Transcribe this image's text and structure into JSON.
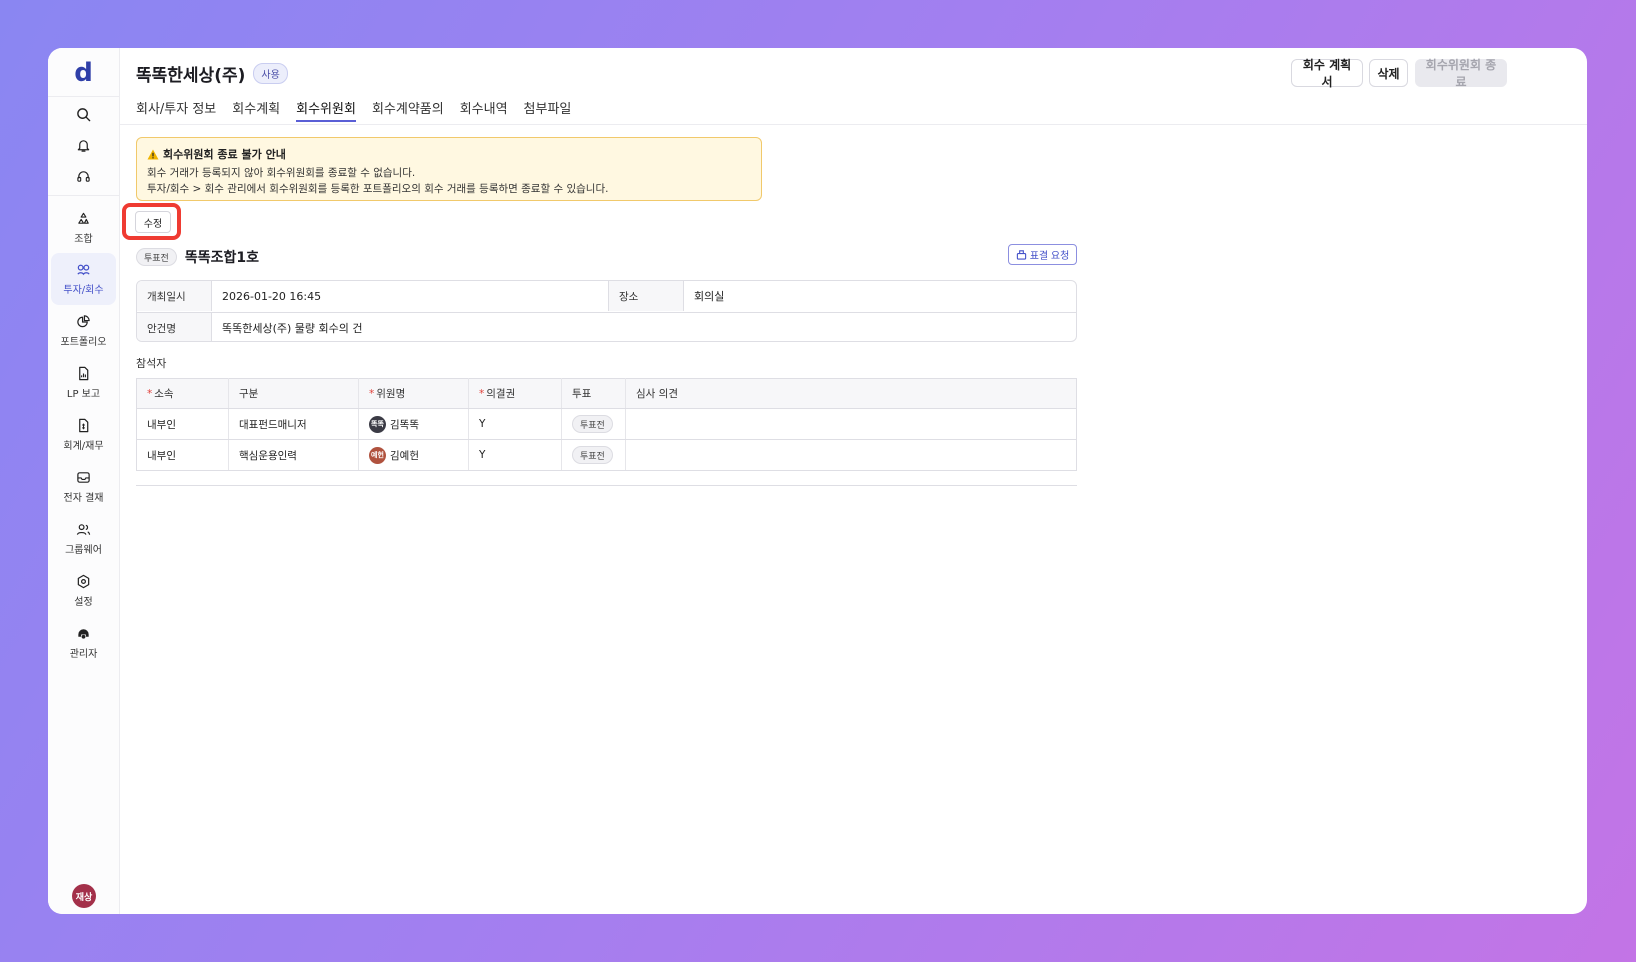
{
  "sidebar": {
    "logo": "d",
    "items": [
      {
        "label": "조합",
        "icon": "recycle-icon",
        "active": false
      },
      {
        "label": "투자/회수",
        "icon": "invest-icon",
        "active": true
      },
      {
        "label": "포트폴리오",
        "icon": "pie-chart-icon",
        "active": false
      },
      {
        "label": "LP 보고",
        "icon": "report-icon",
        "active": false
      },
      {
        "label": "회계/재무",
        "icon": "accounting-icon",
        "active": false
      },
      {
        "label": "전자 결재",
        "icon": "inbox-icon",
        "active": false
      },
      {
        "label": "그룹웨어",
        "icon": "group-icon",
        "active": false
      },
      {
        "label": "설정",
        "icon": "gear-icon",
        "active": false
      },
      {
        "label": "관리자",
        "icon": "admin-icon",
        "active": false
      }
    ],
    "user_avatar": "재상"
  },
  "header": {
    "title": "똑똑한세상(주)",
    "status_badge": "사용",
    "buttons": {
      "plan": "회수 계획서",
      "delete": "삭제",
      "end_committee": "회수위원회 종료"
    },
    "tabs": [
      {
        "label": "회사/투자 정보",
        "active": false
      },
      {
        "label": "회수계획",
        "active": false
      },
      {
        "label": "회수위원회",
        "active": true
      },
      {
        "label": "회수계약품의",
        "active": false
      },
      {
        "label": "회수내역",
        "active": false
      },
      {
        "label": "첨부파일",
        "active": false
      }
    ]
  },
  "notice": {
    "title": "회수위원회 종료 불가 안내",
    "line1": "회수 거래가 등록되지 않아 회수위원회를 종료할 수 없습니다.",
    "line2": "투자/회수 > 회수 관리에서 회수위원회를 등록한 포트폴리오의 회수 거래를 등록하면 종료할 수 있습니다."
  },
  "edit_button": "수정",
  "committee": {
    "vote_status": "투표전",
    "name": "똑똑조합1호",
    "vote_request_label": "표결 요청",
    "info": {
      "date_label": "개최일시",
      "date_value": "2026-01-20 16:45",
      "place_label": "장소",
      "place_value": "회의실",
      "agenda_label": "안건명",
      "agenda_value": "똑똑한세상(주) 물량 회수의 건"
    }
  },
  "participants": {
    "section_label": "참석자",
    "columns": [
      "소속",
      "구분",
      "위원명",
      "의결권",
      "투표",
      "심사 의견"
    ],
    "required_columns": [
      "소속",
      "위원명",
      "의결권"
    ],
    "rows": [
      {
        "affiliation": "내부인",
        "role": "대표펀드매니저",
        "avatar": "똑똑",
        "avatar_color": "#3b3b45",
        "name": "김똑똑",
        "voting_right": "Y",
        "vote": "투표전",
        "opinion": ""
      },
      {
        "affiliation": "내부인",
        "role": "핵심운용인력",
        "avatar": "예헌",
        "avatar_color": "#b0523e",
        "name": "김예헌",
        "voting_right": "Y",
        "vote": "투표전",
        "opinion": ""
      }
    ]
  },
  "colors": {
    "accent": "#4451c9",
    "highlight": "#ef3b32",
    "notice_bg": "#fff8e1"
  }
}
